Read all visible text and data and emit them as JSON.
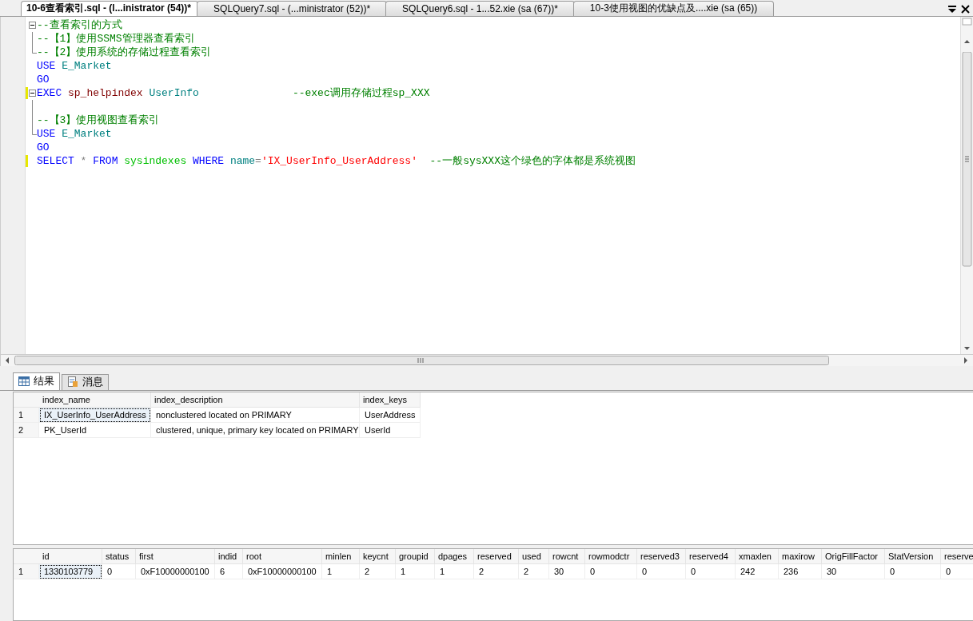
{
  "doc_tabs": [
    {
      "label": "10-6查看索引.sql - (l...inistrator (54))*",
      "selected": true
    },
    {
      "label": "SQLQuery7.sql - (...ministrator (52))*",
      "selected": false
    },
    {
      "label": "SQLQuery6.sql - 1...52.xie (sa (67))*",
      "selected": false
    },
    {
      "label": "10-3使用视图的优缺点及....xie (sa (65))",
      "selected": false
    }
  ],
  "editor": {
    "lines": [
      {
        "kind": "open",
        "changed": false,
        "tokens": [
          {
            "kind": "comment",
            "text": "--查看索引的方式"
          }
        ]
      },
      {
        "kind": "inner",
        "changed": false,
        "tokens": [
          {
            "kind": "comment",
            "text": "--【1】使用SSMS管理器查看索引"
          }
        ]
      },
      {
        "kind": "end",
        "changed": false,
        "tokens": [
          {
            "kind": "comment",
            "text": "--【2】使用系统的存储过程查看索引"
          }
        ]
      },
      {
        "kind": "plain",
        "changed": false,
        "tokens": [
          {
            "kind": "keyword",
            "text": "USE"
          },
          {
            "kind": "ident",
            "text": " E_Market"
          }
        ]
      },
      {
        "kind": "plain",
        "changed": false,
        "tokens": [
          {
            "kind": "keyword",
            "text": "GO"
          }
        ]
      },
      {
        "kind": "open",
        "changed": true,
        "tokens": [
          {
            "kind": "keyword",
            "text": "EXEC"
          },
          {
            "kind": "proc",
            "text": " sp_helpindex"
          },
          {
            "kind": "ident",
            "text": " UserInfo"
          },
          {
            "kind": "comment",
            "text": "               --exec调用存储过程sp_XXX"
          }
        ]
      },
      {
        "kind": "inner",
        "changed": false
      },
      {
        "kind": "inner",
        "changed": false,
        "tokens": [
          {
            "kind": "comment",
            "text": "--【3】使用视图查看索引"
          }
        ]
      },
      {
        "kind": "end",
        "changed": false,
        "tokens": [
          {
            "kind": "keyword",
            "text": "USE"
          },
          {
            "kind": "ident",
            "text": " E_Market"
          }
        ]
      },
      {
        "kind": "plain",
        "changed": false,
        "tokens": [
          {
            "kind": "keyword",
            "text": "GO"
          }
        ]
      },
      {
        "kind": "plain",
        "changed": true,
        "tokens": [
          {
            "kind": "keyword",
            "text": "SELECT"
          },
          {
            "kind": "operator",
            "text": " *"
          },
          {
            "kind": "keyword",
            "text": " FROM"
          },
          {
            "kind": "sysobj",
            "text": " sysindexes"
          },
          {
            "kind": "keyword",
            "text": " WHERE"
          },
          {
            "kind": "ident",
            "text": " name"
          },
          {
            "kind": "operator",
            "text": "="
          },
          {
            "kind": "string",
            "text": "'IX_UserInfo_UserAddress'"
          },
          {
            "kind": "comment",
            "text": "  --一般sysXXX这个绿色的字体都是系统视图"
          }
        ]
      }
    ]
  },
  "result_tabs": [
    {
      "label": "结果",
      "selected": true
    },
    {
      "label": "消息",
      "selected": false
    }
  ],
  "grids": [
    {
      "columns": [
        "index_name",
        "index_description",
        "index_keys"
      ],
      "rows": [
        {
          "num": "1",
          "selected": true,
          "cells": [
            "IX_UserInfo_UserAddress",
            "nonclustered located on PRIMARY",
            "UserAddress"
          ]
        },
        {
          "num": "2",
          "selected": false,
          "cells": [
            "PK_UserId",
            "clustered, unique, primary key located on PRIMARY",
            "UserId"
          ]
        }
      ]
    },
    {
      "columns": [
        "id",
        "status",
        "first",
        "indid",
        "root",
        "minlen",
        "keycnt",
        "groupid",
        "dpages",
        "reserved",
        "used",
        "rowcnt",
        "rowmodctr",
        "reserved3",
        "reserved4",
        "xmaxlen",
        "maxirow",
        "OrigFillFactor",
        "StatVersion",
        "reserve"
      ],
      "rows": [
        {
          "num": "1",
          "selected": true,
          "cells": [
            "1330103779",
            "0",
            "0xF10000000100",
            "6",
            "0xF10000000100",
            "1",
            "2",
            "1",
            "1",
            "2",
            "2",
            "30",
            "0",
            "0",
            "0",
            "242",
            "236",
            "30",
            "0",
            "0"
          ]
        }
      ]
    }
  ]
}
